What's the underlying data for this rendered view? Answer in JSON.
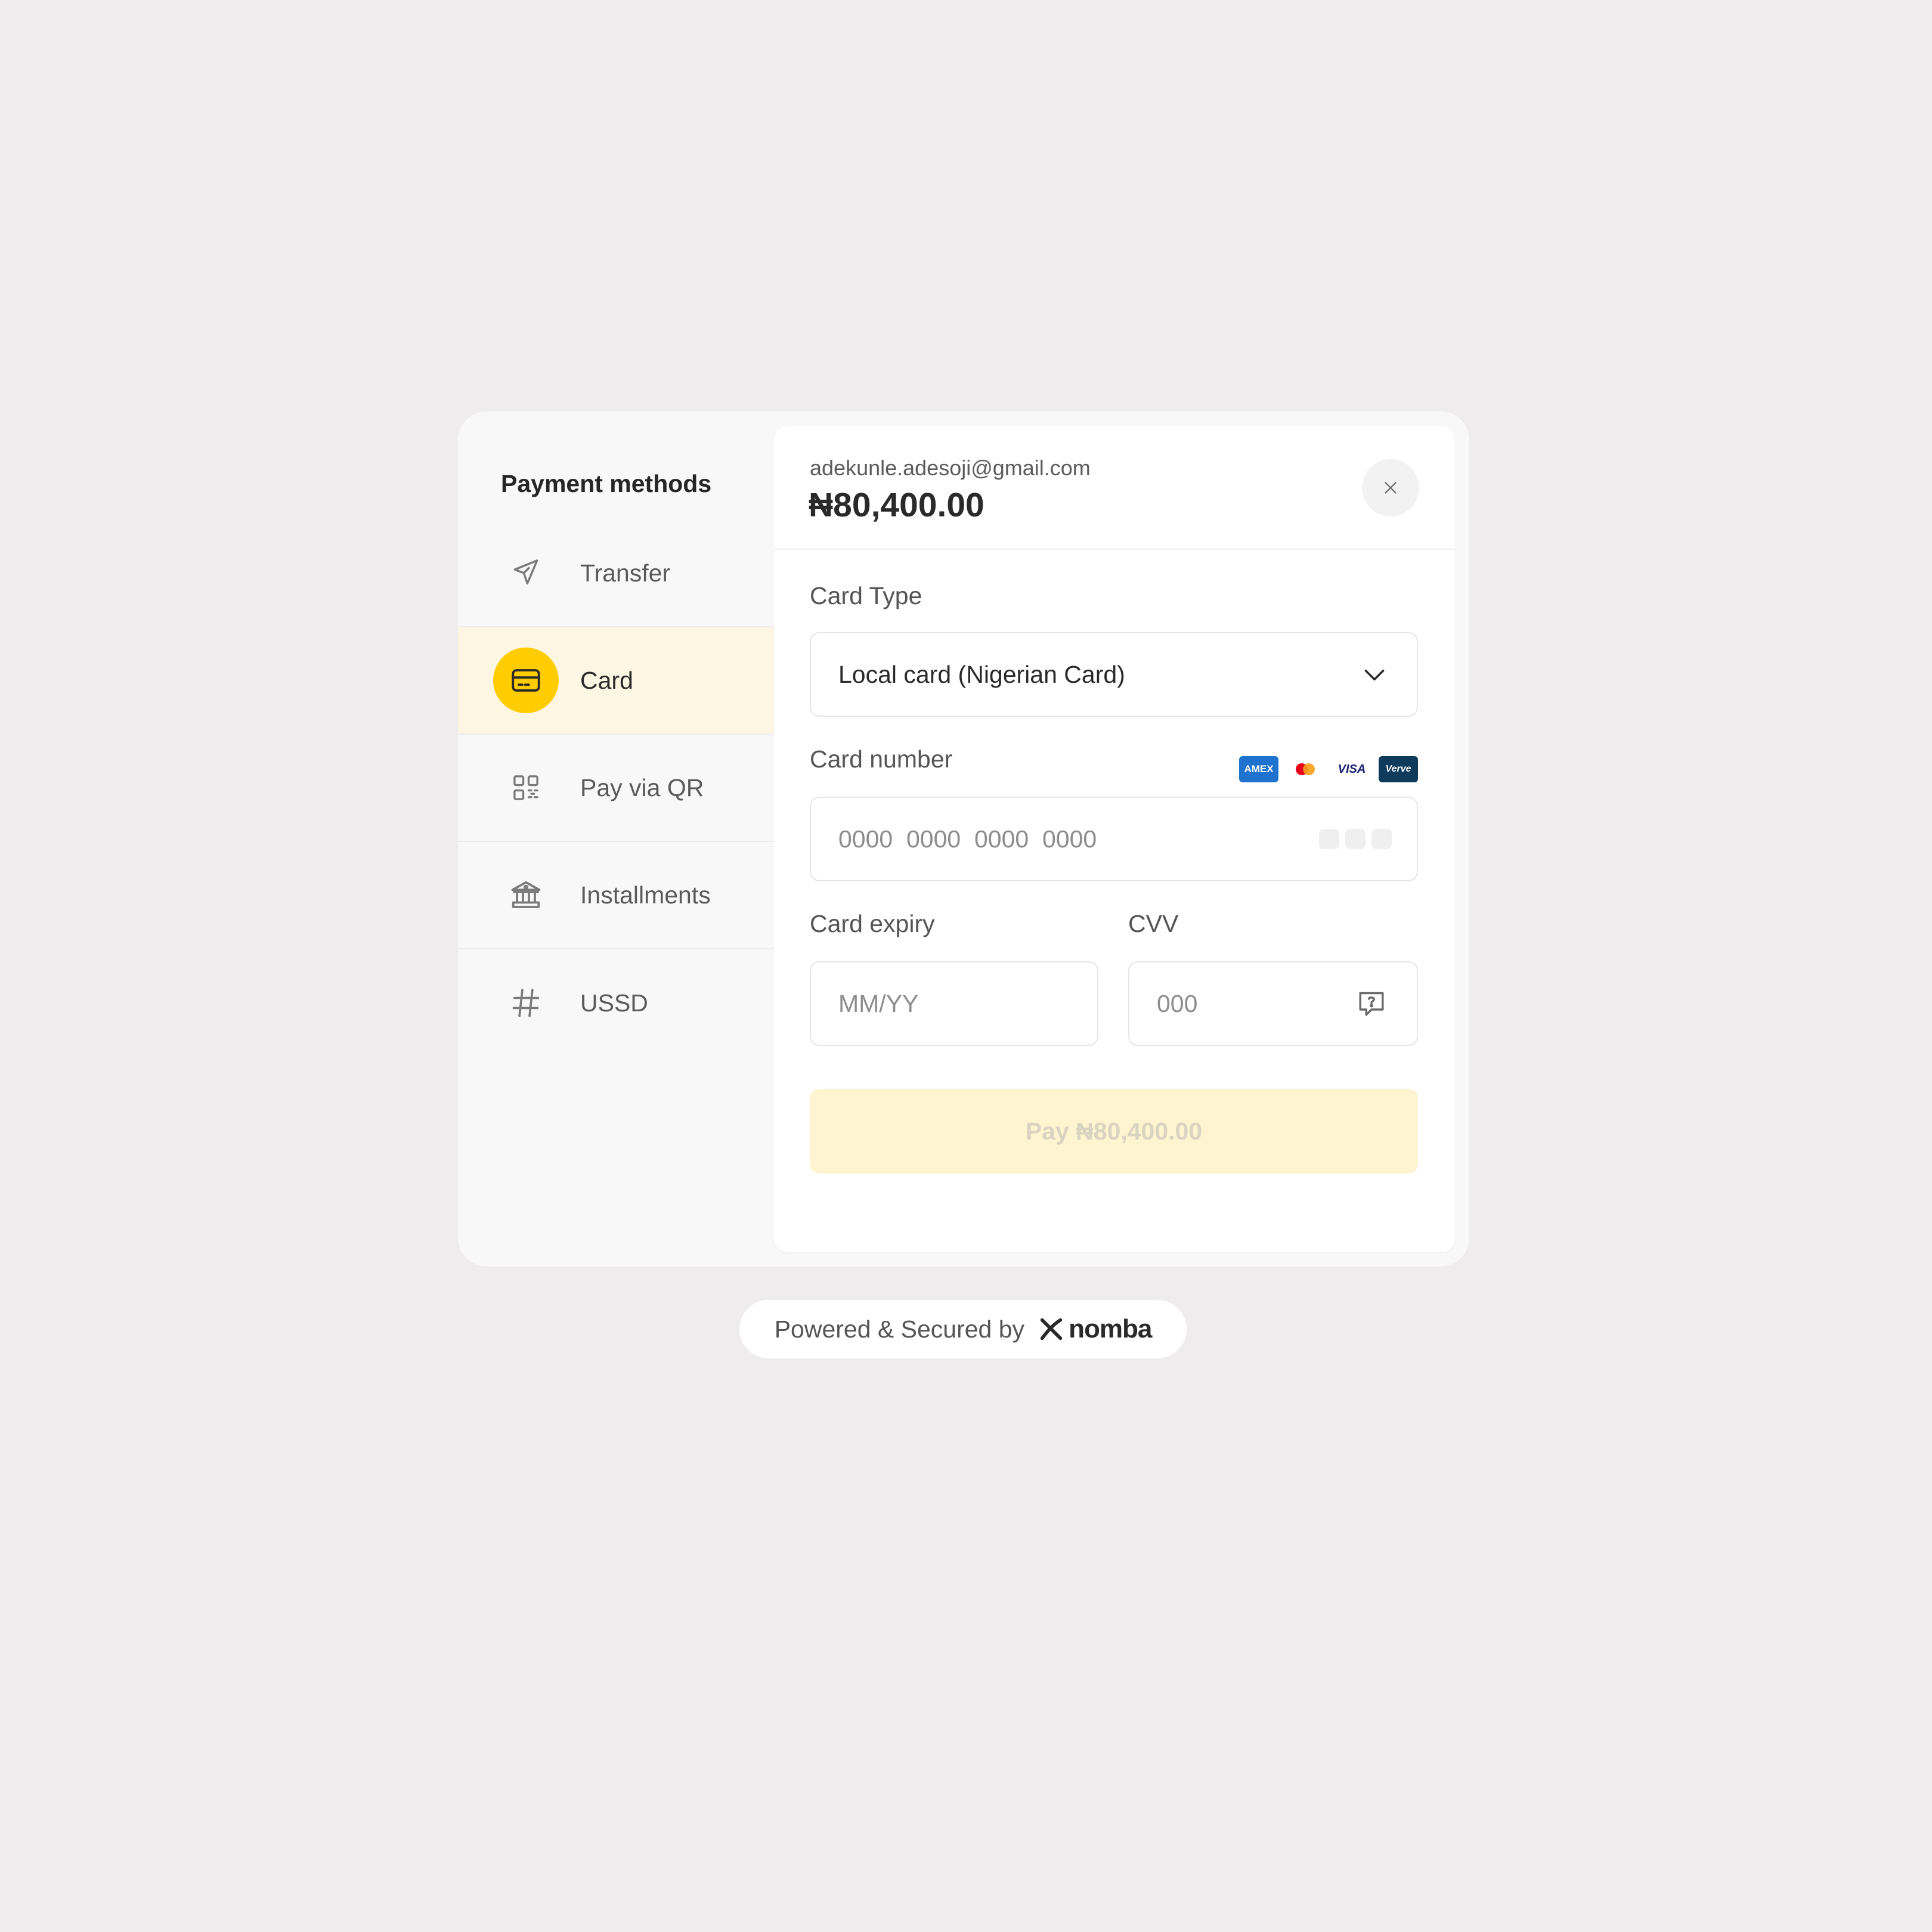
{
  "sidebar": {
    "title": "Payment methods",
    "items": [
      {
        "label": "Transfer",
        "icon": "send-icon"
      },
      {
        "label": "Card",
        "icon": "credit-card-icon",
        "active": true
      },
      {
        "label": "Pay via QR",
        "icon": "qr-code-icon"
      },
      {
        "label": "Installments",
        "icon": "bank-icon"
      },
      {
        "label": "USSD",
        "icon": "hash-icon"
      }
    ]
  },
  "header": {
    "email": "adekunle.adesoji@gmail.com",
    "amount": "₦80,400.00"
  },
  "form": {
    "card_type_label": "Card Type",
    "card_type_value": "Local card (Nigerian Card)",
    "card_number_label": "Card number",
    "card_number_placeholder": "0000  0000  0000  0000",
    "card_brands": [
      "Amex",
      "Mastercard",
      "Visa",
      "Verve"
    ],
    "card_brand_texts": {
      "amex": "AMEX",
      "visa": "VISA",
      "verve": "Verve"
    },
    "expiry_label": "Card expiry",
    "expiry_placeholder": "MM/YY",
    "cvv_label": "CVV",
    "cvv_placeholder": "000",
    "pay_button": "Pay ₦80,400.00"
  },
  "footer": {
    "text": "Powered & Secured by",
    "brand": "nomba"
  },
  "colors": {
    "accent": "#FFCC00",
    "active_bg": "#FDF6E3",
    "pay_button_bg": "#FEF4CF",
    "page_bg": "#EEECED"
  }
}
